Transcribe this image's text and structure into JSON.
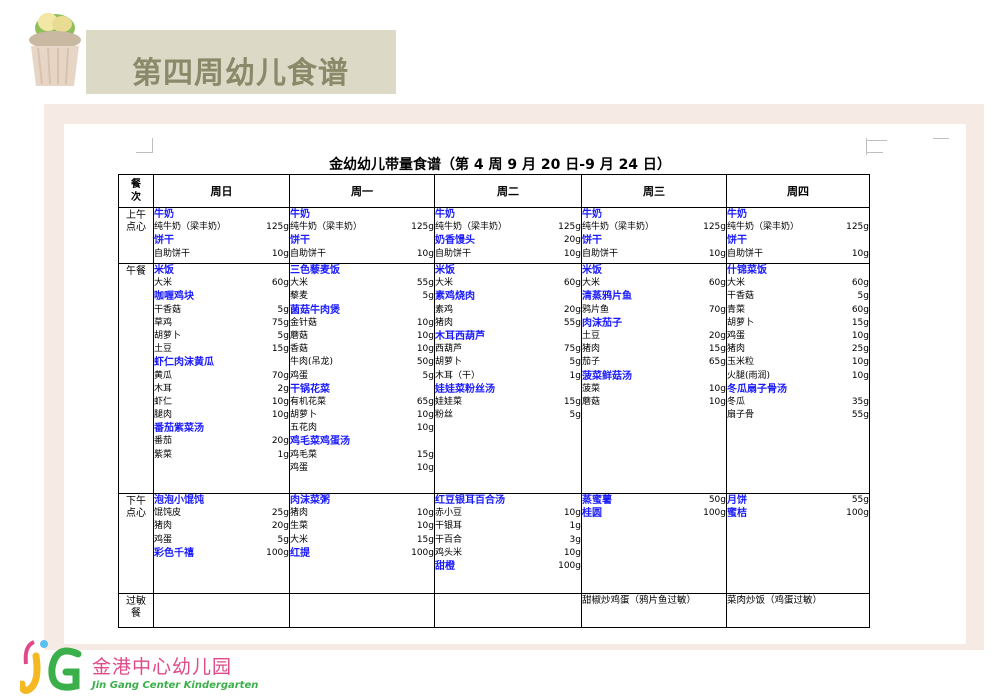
{
  "slide": {
    "title": "第四周幼儿食谱",
    "logo_text": "金港中心幼儿园",
    "logo_subtitle": "Jin Gang Center Kindergarten"
  },
  "document": {
    "title": "金幼幼儿带量食谱（第 4 周   9 月 20 日-9 月 24 日）",
    "corner_header": "餐次",
    "days": [
      "周日",
      "周一",
      "周二",
      "周三",
      "周四"
    ],
    "meal_labels": [
      "上午点心",
      "午餐",
      "下午点心",
      "过敏餐"
    ],
    "rows": {
      "morning": [
        [
          {
            "t": "d",
            "n": "牛奶"
          },
          {
            "t": "i",
            "n": "纯牛奶（梁丰奶）",
            "q": "125g"
          },
          {
            "t": "d",
            "n": "饼干"
          },
          {
            "t": "i",
            "n": "自助饼干",
            "q": "10g"
          }
        ],
        [
          {
            "t": "d",
            "n": "牛奶"
          },
          {
            "t": "i",
            "n": "纯牛奶（梁丰奶）",
            "q": "125g"
          },
          {
            "t": "d",
            "n": "饼干"
          },
          {
            "t": "i",
            "n": "自助饼干",
            "q": "10g"
          }
        ],
        [
          {
            "t": "d",
            "n": "牛奶"
          },
          {
            "t": "i",
            "n": "纯牛奶（梁丰奶）",
            "q": "125g"
          },
          {
            "t": "d",
            "n": "奶香馒头",
            "q": "20g"
          },
          {
            "t": "i",
            "n": "自助饼干",
            "q": "10g"
          }
        ],
        [
          {
            "t": "d",
            "n": "牛奶"
          },
          {
            "t": "i",
            "n": "纯牛奶（梁丰奶）",
            "q": "125g"
          },
          {
            "t": "d",
            "n": "饼干"
          },
          {
            "t": "i",
            "n": "自助饼干",
            "q": "10g"
          }
        ],
        [
          {
            "t": "d",
            "n": "牛奶"
          },
          {
            "t": "i",
            "n": "纯牛奶（梁丰奶）",
            "q": "125g"
          },
          {
            "t": "d",
            "n": "饼干"
          },
          {
            "t": "i",
            "n": "自助饼干",
            "q": "10g"
          }
        ]
      ],
      "lunch": [
        [
          {
            "t": "d",
            "n": "米饭"
          },
          {
            "t": "i",
            "n": "大米",
            "q": "60g"
          },
          {
            "t": "d",
            "n": "咖喱鸡块"
          },
          {
            "t": "i",
            "n": "干香菇",
            "q": "5g"
          },
          {
            "t": "i",
            "n": "草鸡",
            "q": "75g"
          },
          {
            "t": "i",
            "n": "胡萝卜",
            "q": "5g"
          },
          {
            "t": "i",
            "n": "土豆",
            "q": "15g"
          },
          {
            "t": "d",
            "n": "虾仁肉沫黄瓜"
          },
          {
            "t": "i",
            "n": "黄瓜",
            "q": "70g"
          },
          {
            "t": "i",
            "n": "木耳",
            "q": "2g"
          },
          {
            "t": "i",
            "n": "虾仁",
            "q": "10g"
          },
          {
            "t": "i",
            "n": "腿肉",
            "q": "10g"
          },
          {
            "t": "d",
            "n": "番茄紫菜汤"
          },
          {
            "t": "i",
            "n": "番茄",
            "q": "20g"
          },
          {
            "t": "i",
            "n": "紫菜",
            "q": "1g"
          }
        ],
        [
          {
            "t": "d",
            "n": "三色藜麦饭"
          },
          {
            "t": "i",
            "n": "大米",
            "q": "55g"
          },
          {
            "t": "i",
            "n": "藜麦",
            "q": "5g"
          },
          {
            "t": "d",
            "n": "菌菇牛肉煲"
          },
          {
            "t": "i",
            "n": "金针菇",
            "q": "10g"
          },
          {
            "t": "i",
            "n": "蘑菇",
            "q": "10g"
          },
          {
            "t": "i",
            "n": "香菇",
            "q": "10g"
          },
          {
            "t": "i",
            "n": "牛肉(吊龙)",
            "q": "50g"
          },
          {
            "t": "i",
            "n": "鸡蛋",
            "q": "5g"
          },
          {
            "t": "d",
            "n": "干锅花菜"
          },
          {
            "t": "i",
            "n": "有机花菜",
            "q": "65g"
          },
          {
            "t": "i",
            "n": "胡萝卜",
            "q": "10g"
          },
          {
            "t": "i",
            "n": "五花肉",
            "q": "10g"
          },
          {
            "t": "d",
            "n": "鸡毛菜鸡蛋汤"
          },
          {
            "t": "i",
            "n": "鸡毛菜",
            "q": "15g"
          },
          {
            "t": "i",
            "n": "鸡蛋",
            "q": "10g"
          }
        ],
        [
          {
            "t": "d",
            "n": "米饭"
          },
          {
            "t": "i",
            "n": "大米",
            "q": "60g"
          },
          {
            "t": "d",
            "n": "素鸡烧肉"
          },
          {
            "t": "i",
            "n": "素鸡",
            "q": "20g"
          },
          {
            "t": "i",
            "n": "猪肉",
            "q": "55g"
          },
          {
            "t": "d",
            "n": "木耳西葫芦"
          },
          {
            "t": "i",
            "n": "西葫芦",
            "q": "75g"
          },
          {
            "t": "i",
            "n": "胡萝卜",
            "q": "5g"
          },
          {
            "t": "i",
            "n": "木耳（干）",
            "q": "1g"
          },
          {
            "t": "d",
            "n": "娃娃菜粉丝汤"
          },
          {
            "t": "i",
            "n": "娃娃菜",
            "q": "15g"
          },
          {
            "t": "i",
            "n": "粉丝",
            "q": "5g"
          }
        ],
        [
          {
            "t": "d",
            "n": "米饭"
          },
          {
            "t": "i",
            "n": "大米",
            "q": "60g"
          },
          {
            "t": "d",
            "n": "清蒸鸦片鱼"
          },
          {
            "t": "i",
            "n": "鸦片鱼",
            "q": "70g"
          },
          {
            "t": "d",
            "n": "肉沫茄子"
          },
          {
            "t": "i",
            "n": "土豆",
            "q": "20g"
          },
          {
            "t": "i",
            "n": "猪肉",
            "q": "15g"
          },
          {
            "t": "i",
            "n": "茄子",
            "q": "65g"
          },
          {
            "t": "d",
            "n": "菠菜鲜菇汤"
          },
          {
            "t": "i",
            "n": "菠菜",
            "q": "10g"
          },
          {
            "t": "i",
            "n": "蘑菇",
            "q": "10g"
          }
        ],
        [
          {
            "t": "d",
            "n": "什锦菜饭"
          },
          {
            "t": "i",
            "n": "大米",
            "q": "60g"
          },
          {
            "t": "i",
            "n": "干香菇",
            "q": "5g"
          },
          {
            "t": "i",
            "n": "青菜",
            "q": "60g"
          },
          {
            "t": "i",
            "n": "胡萝卜",
            "q": "15g"
          },
          {
            "t": "i",
            "n": "鸡蛋",
            "q": "10g"
          },
          {
            "t": "i",
            "n": "猪肉",
            "q": "25g"
          },
          {
            "t": "i",
            "n": "玉米粒",
            "q": "10g"
          },
          {
            "t": "i",
            "n": "火腿(雨润)",
            "q": "10g"
          },
          {
            "t": "d",
            "n": "冬瓜扇子骨汤"
          },
          {
            "t": "i",
            "n": "冬瓜",
            "q": "35g"
          },
          {
            "t": "i",
            "n": "扇子骨",
            "q": "55g"
          }
        ]
      ],
      "afternoon": [
        [
          {
            "t": "d",
            "n": "泡泡小馄饨"
          },
          {
            "t": "i",
            "n": "馄饨皮",
            "q": "25g"
          },
          {
            "t": "i",
            "n": "猪肉",
            "q": "20g"
          },
          {
            "t": "i",
            "n": "鸡蛋",
            "q": "5g"
          },
          {
            "t": "d",
            "n": "彩色千禧",
            "q": "100g"
          }
        ],
        [
          {
            "t": "d",
            "n": "肉沫菜粥"
          },
          {
            "t": "i",
            "n": "猪肉",
            "q": "10g"
          },
          {
            "t": "i",
            "n": "生菜",
            "q": "10g"
          },
          {
            "t": "i",
            "n": "大米",
            "q": "15g"
          },
          {
            "t": "d",
            "n": "红提",
            "q": "100g"
          }
        ],
        [
          {
            "t": "d",
            "n": "红豆银耳百合汤"
          },
          {
            "t": "i",
            "n": "赤小豆",
            "q": "10g"
          },
          {
            "t": "i",
            "n": "干银耳",
            "q": "1g"
          },
          {
            "t": "i",
            "n": "干百合",
            "q": "3g"
          },
          {
            "t": "i",
            "n": "鸡头米",
            "q": "10g"
          },
          {
            "t": "d",
            "n": "甜橙",
            "q": "100g"
          }
        ],
        [
          {
            "t": "d",
            "n": "蒸蜜薯",
            "q": "50g"
          },
          {
            "t": "d",
            "n": "桂圆",
            "q": "100g"
          }
        ],
        [
          {
            "t": "d",
            "n": "月饼",
            "q": "55g"
          },
          {
            "t": "d",
            "n": "蜜桔",
            "q": "100g"
          }
        ]
      ],
      "allergy": [
        "",
        "",
        "",
        "甜椒炒鸡蛋（鸦片鱼过敏）",
        "菜肉炒饭（鸡蛋过敏）"
      ]
    }
  },
  "colors": {
    "dish": "#1a1aff",
    "header_band": "#dcd9c6",
    "title": "#8a8a6a",
    "frame": "#f6ebe4",
    "logo_pink": "#e04a8a",
    "logo_green": "#3aaf4a"
  },
  "icons": [
    "cupcake-icon",
    "kindergarten-logo-icon"
  ]
}
